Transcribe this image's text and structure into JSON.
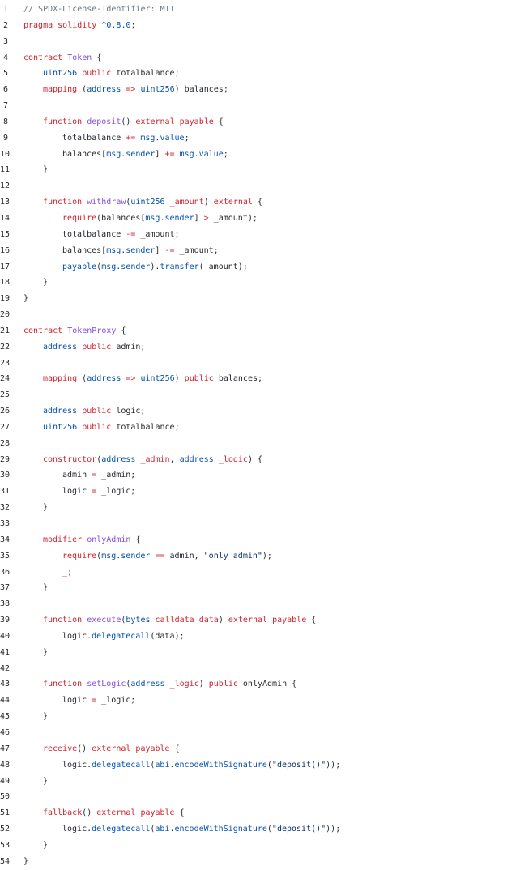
{
  "editor": {
    "colors": {
      "comment": "#6e7781",
      "keyword": "#cf222e",
      "type": "#0550ae",
      "function": "#8250df",
      "string": "#0a3069",
      "plain": "#24292f"
    },
    "lines": [
      {
        "n": "1",
        "indent": 0,
        "tokens": [
          [
            "c",
            "// SPDX-License-Identifier: MIT"
          ]
        ]
      },
      {
        "n": "2",
        "indent": 0,
        "tokens": [
          [
            "k",
            "pragma"
          ],
          [
            "p",
            " "
          ],
          [
            "k",
            "solidity"
          ],
          [
            "p",
            " "
          ],
          [
            "t",
            "^0.8.0"
          ],
          [
            "p",
            ";"
          ]
        ]
      },
      {
        "n": "3",
        "indent": 0,
        "tokens": []
      },
      {
        "n": "4",
        "indent": 0,
        "tokens": [
          [
            "k",
            "contract"
          ],
          [
            "p",
            " "
          ],
          [
            "f",
            "Token"
          ],
          [
            "p",
            " {"
          ]
        ]
      },
      {
        "n": "5",
        "indent": 1,
        "tokens": [
          [
            "t",
            "uint256"
          ],
          [
            "p",
            " "
          ],
          [
            "k",
            "public"
          ],
          [
            "p",
            " totalbalance;"
          ]
        ]
      },
      {
        "n": "6",
        "indent": 1,
        "tokens": [
          [
            "k",
            "mapping"
          ],
          [
            "p",
            " ("
          ],
          [
            "t",
            "address"
          ],
          [
            "p",
            " "
          ],
          [
            "k",
            "=>"
          ],
          [
            "p",
            " "
          ],
          [
            "t",
            "uint256"
          ],
          [
            "p",
            ") balances;"
          ]
        ]
      },
      {
        "n": "7",
        "indent": 0,
        "tokens": []
      },
      {
        "n": "8",
        "indent": 1,
        "tokens": [
          [
            "k",
            "function"
          ],
          [
            "p",
            " "
          ],
          [
            "f",
            "deposit"
          ],
          [
            "p",
            "() "
          ],
          [
            "k",
            "external"
          ],
          [
            "p",
            " "
          ],
          [
            "k",
            "payable"
          ],
          [
            "p",
            " {"
          ]
        ]
      },
      {
        "n": "9",
        "indent": 2,
        "tokens": [
          [
            "p",
            "totalbalance "
          ],
          [
            "k",
            "+="
          ],
          [
            "p",
            " "
          ],
          [
            "t",
            "msg"
          ],
          [
            "p",
            "."
          ],
          [
            "t",
            "value"
          ],
          [
            "p",
            ";"
          ]
        ]
      },
      {
        "n": "10",
        "indent": 2,
        "tokens": [
          [
            "p",
            "balances["
          ],
          [
            "t",
            "msg"
          ],
          [
            "p",
            "."
          ],
          [
            "t",
            "sender"
          ],
          [
            "p",
            "] "
          ],
          [
            "k",
            "+="
          ],
          [
            "p",
            " "
          ],
          [
            "t",
            "msg"
          ],
          [
            "p",
            "."
          ],
          [
            "t",
            "value"
          ],
          [
            "p",
            ";"
          ]
        ]
      },
      {
        "n": "11",
        "indent": 1,
        "tokens": [
          [
            "p",
            "}"
          ]
        ]
      },
      {
        "n": "12",
        "indent": 0,
        "tokens": []
      },
      {
        "n": "13",
        "indent": 1,
        "tokens": [
          [
            "k",
            "function"
          ],
          [
            "p",
            " "
          ],
          [
            "f",
            "withdraw"
          ],
          [
            "p",
            "("
          ],
          [
            "t",
            "uint256"
          ],
          [
            "p",
            " "
          ],
          [
            "k",
            "_amount"
          ],
          [
            "p",
            ") "
          ],
          [
            "k",
            "external"
          ],
          [
            "p",
            " {"
          ]
        ]
      },
      {
        "n": "14",
        "indent": 2,
        "tokens": [
          [
            "k",
            "require"
          ],
          [
            "p",
            "(balances["
          ],
          [
            "t",
            "msg"
          ],
          [
            "p",
            "."
          ],
          [
            "t",
            "sender"
          ],
          [
            "p",
            "] "
          ],
          [
            "k",
            ">"
          ],
          [
            "p",
            " _amount);"
          ]
        ]
      },
      {
        "n": "15",
        "indent": 2,
        "tokens": [
          [
            "p",
            "totalbalance "
          ],
          [
            "k",
            "-="
          ],
          [
            "p",
            " _amount;"
          ]
        ]
      },
      {
        "n": "16",
        "indent": 2,
        "tokens": [
          [
            "p",
            "balances["
          ],
          [
            "t",
            "msg"
          ],
          [
            "p",
            "."
          ],
          [
            "t",
            "sender"
          ],
          [
            "p",
            "] "
          ],
          [
            "k",
            "-="
          ],
          [
            "p",
            " _amount;"
          ]
        ]
      },
      {
        "n": "17",
        "indent": 2,
        "tokens": [
          [
            "t",
            "payable"
          ],
          [
            "p",
            "("
          ],
          [
            "t",
            "msg"
          ],
          [
            "p",
            "."
          ],
          [
            "t",
            "sender"
          ],
          [
            "p",
            ")."
          ],
          [
            "t",
            "transfer"
          ],
          [
            "p",
            "(_amount);"
          ]
        ]
      },
      {
        "n": "18",
        "indent": 1,
        "tokens": [
          [
            "p",
            "}"
          ]
        ]
      },
      {
        "n": "19",
        "indent": 0,
        "tokens": [
          [
            "p",
            "}"
          ]
        ]
      },
      {
        "n": "20",
        "indent": 0,
        "tokens": []
      },
      {
        "n": "21",
        "indent": 0,
        "tokens": [
          [
            "k",
            "contract"
          ],
          [
            "p",
            " "
          ],
          [
            "f",
            "TokenProxy"
          ],
          [
            "p",
            " {"
          ]
        ]
      },
      {
        "n": "22",
        "indent": 1,
        "tokens": [
          [
            "t",
            "address"
          ],
          [
            "p",
            " "
          ],
          [
            "k",
            "public"
          ],
          [
            "p",
            " admin;"
          ]
        ]
      },
      {
        "n": "23",
        "indent": 0,
        "tokens": []
      },
      {
        "n": "24",
        "indent": 1,
        "tokens": [
          [
            "k",
            "mapping"
          ],
          [
            "p",
            " ("
          ],
          [
            "t",
            "address"
          ],
          [
            "p",
            " "
          ],
          [
            "k",
            "=>"
          ],
          [
            "p",
            " "
          ],
          [
            "t",
            "uint256"
          ],
          [
            "p",
            ") "
          ],
          [
            "k",
            "public"
          ],
          [
            "p",
            " balances;"
          ]
        ]
      },
      {
        "n": "25",
        "indent": 0,
        "tokens": []
      },
      {
        "n": "26",
        "indent": 1,
        "tokens": [
          [
            "t",
            "address"
          ],
          [
            "p",
            " "
          ],
          [
            "k",
            "public"
          ],
          [
            "p",
            " logic;"
          ]
        ]
      },
      {
        "n": "27",
        "indent": 1,
        "tokens": [
          [
            "t",
            "uint256"
          ],
          [
            "p",
            " "
          ],
          [
            "k",
            "public"
          ],
          [
            "p",
            " totalbalance;"
          ]
        ]
      },
      {
        "n": "28",
        "indent": 0,
        "tokens": []
      },
      {
        "n": "29",
        "indent": 1,
        "tokens": [
          [
            "k",
            "constructor"
          ],
          [
            "p",
            "("
          ],
          [
            "t",
            "address"
          ],
          [
            "p",
            " "
          ],
          [
            "k",
            "_admin"
          ],
          [
            "p",
            ", "
          ],
          [
            "t",
            "address"
          ],
          [
            "p",
            " "
          ],
          [
            "k",
            "_logic"
          ],
          [
            "p",
            ") {"
          ]
        ]
      },
      {
        "n": "30",
        "indent": 2,
        "tokens": [
          [
            "p",
            "admin "
          ],
          [
            "k",
            "="
          ],
          [
            "p",
            " _admin;"
          ]
        ]
      },
      {
        "n": "31",
        "indent": 2,
        "tokens": [
          [
            "p",
            "logic "
          ],
          [
            "k",
            "="
          ],
          [
            "p",
            " _logic;"
          ]
        ]
      },
      {
        "n": "32",
        "indent": 1,
        "tokens": [
          [
            "p",
            "}"
          ]
        ]
      },
      {
        "n": "33",
        "indent": 0,
        "tokens": []
      },
      {
        "n": "34",
        "indent": 1,
        "tokens": [
          [
            "k",
            "modifier"
          ],
          [
            "p",
            " "
          ],
          [
            "f",
            "onlyAdmin"
          ],
          [
            "p",
            " {"
          ]
        ]
      },
      {
        "n": "35",
        "indent": 2,
        "tokens": [
          [
            "k",
            "require"
          ],
          [
            "p",
            "("
          ],
          [
            "t",
            "msg"
          ],
          [
            "p",
            "."
          ],
          [
            "t",
            "sender"
          ],
          [
            "p",
            " "
          ],
          [
            "k",
            "=="
          ],
          [
            "p",
            " admin, "
          ],
          [
            "s",
            "\"only admin\""
          ],
          [
            "p",
            ");"
          ]
        ]
      },
      {
        "n": "36",
        "indent": 2,
        "tokens": [
          [
            "k",
            "_;"
          ]
        ]
      },
      {
        "n": "37",
        "indent": 1,
        "tokens": [
          [
            "p",
            "}"
          ]
        ]
      },
      {
        "n": "38",
        "indent": 0,
        "tokens": []
      },
      {
        "n": "39",
        "indent": 1,
        "tokens": [
          [
            "k",
            "function"
          ],
          [
            "p",
            " "
          ],
          [
            "f",
            "execute"
          ],
          [
            "p",
            "("
          ],
          [
            "t",
            "bytes"
          ],
          [
            "p",
            " "
          ],
          [
            "k",
            "calldata"
          ],
          [
            "p",
            " "
          ],
          [
            "k",
            "data"
          ],
          [
            "p",
            ") "
          ],
          [
            "k",
            "external"
          ],
          [
            "p",
            " "
          ],
          [
            "k",
            "payable"
          ],
          [
            "p",
            " {"
          ]
        ]
      },
      {
        "n": "40",
        "indent": 2,
        "tokens": [
          [
            "p",
            "logic."
          ],
          [
            "t",
            "delegatecall"
          ],
          [
            "p",
            "(data);"
          ]
        ]
      },
      {
        "n": "41",
        "indent": 1,
        "tokens": [
          [
            "p",
            "}"
          ]
        ]
      },
      {
        "n": "42",
        "indent": 0,
        "tokens": []
      },
      {
        "n": "43",
        "indent": 1,
        "tokens": [
          [
            "k",
            "function"
          ],
          [
            "p",
            " "
          ],
          [
            "f",
            "setLogic"
          ],
          [
            "p",
            "("
          ],
          [
            "t",
            "address"
          ],
          [
            "p",
            " "
          ],
          [
            "k",
            "_logic"
          ],
          [
            "p",
            ") "
          ],
          [
            "k",
            "public"
          ],
          [
            "p",
            " onlyAdmin {"
          ]
        ]
      },
      {
        "n": "44",
        "indent": 2,
        "tokens": [
          [
            "p",
            "logic "
          ],
          [
            "k",
            "="
          ],
          [
            "p",
            " _logic;"
          ]
        ]
      },
      {
        "n": "45",
        "indent": 1,
        "tokens": [
          [
            "p",
            "}"
          ]
        ]
      },
      {
        "n": "46",
        "indent": 0,
        "tokens": []
      },
      {
        "n": "47",
        "indent": 1,
        "tokens": [
          [
            "k",
            "receive"
          ],
          [
            "p",
            "() "
          ],
          [
            "k",
            "external"
          ],
          [
            "p",
            " "
          ],
          [
            "k",
            "payable"
          ],
          [
            "p",
            " {"
          ]
        ]
      },
      {
        "n": "48",
        "indent": 2,
        "tokens": [
          [
            "p",
            "logic."
          ],
          [
            "t",
            "delegatecall"
          ],
          [
            "p",
            "("
          ],
          [
            "t",
            "abi"
          ],
          [
            "p",
            "."
          ],
          [
            "t",
            "encodeWithSignature"
          ],
          [
            "p",
            "("
          ],
          [
            "s",
            "\"deposit()\""
          ],
          [
            "p",
            "));"
          ]
        ]
      },
      {
        "n": "49",
        "indent": 1,
        "tokens": [
          [
            "p",
            "}"
          ]
        ]
      },
      {
        "n": "50",
        "indent": 0,
        "tokens": []
      },
      {
        "n": "51",
        "indent": 1,
        "tokens": [
          [
            "k",
            "fallback"
          ],
          [
            "p",
            "() "
          ],
          [
            "k",
            "external"
          ],
          [
            "p",
            " "
          ],
          [
            "k",
            "payable"
          ],
          [
            "p",
            " {"
          ]
        ]
      },
      {
        "n": "52",
        "indent": 2,
        "tokens": [
          [
            "p",
            "logic."
          ],
          [
            "t",
            "delegatecall"
          ],
          [
            "p",
            "("
          ],
          [
            "t",
            "abi"
          ],
          [
            "p",
            "."
          ],
          [
            "t",
            "encodeWithSignature"
          ],
          [
            "p",
            "("
          ],
          [
            "s",
            "\"deposit()\""
          ],
          [
            "p",
            "));"
          ]
        ]
      },
      {
        "n": "53",
        "indent": 1,
        "tokens": [
          [
            "p",
            "}"
          ]
        ]
      },
      {
        "n": "54",
        "indent": 0,
        "tokens": [
          [
            "p",
            "}"
          ]
        ]
      }
    ]
  }
}
